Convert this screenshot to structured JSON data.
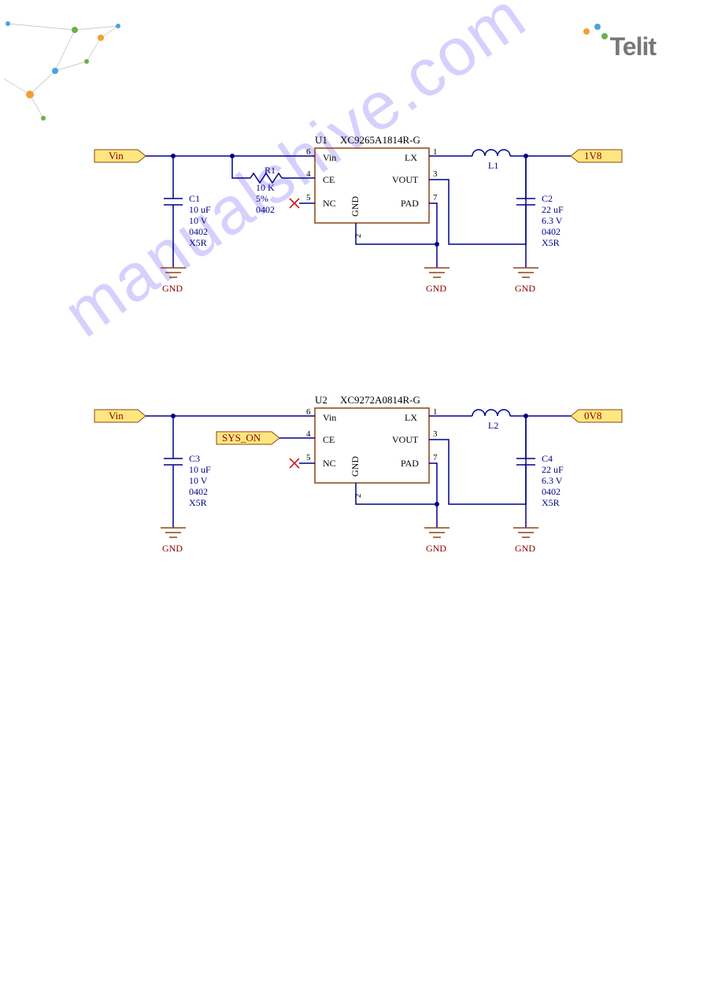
{
  "logo": {
    "text": "Telit"
  },
  "watermark": "manualshive.com",
  "circuit1": {
    "vin_label": "Vin",
    "out_label": "1V8",
    "ic": {
      "ref": "U1",
      "part": "XC9265A1814R-G",
      "pins": {
        "vin": "Vin",
        "ce": "CE",
        "nc": "NC",
        "lx": "LX",
        "vout": "VOUT",
        "pad": "PAD",
        "gnd": "GND",
        "n6": "6",
        "n4": "4",
        "n5": "5",
        "n1": "1",
        "n3": "3",
        "n7": "7",
        "n2": "2"
      }
    },
    "r1": {
      "ref": "R1",
      "val": "10 K",
      "tol": "5%",
      "pkg": "0402"
    },
    "c1": {
      "ref": "C1",
      "val": "10 uF",
      "volt": "10 V",
      "pkg": "0402",
      "di": "X5R"
    },
    "c2": {
      "ref": "C2",
      "val": "22 uF",
      "volt": "6.3 V",
      "pkg": "0402",
      "di": "X5R"
    },
    "l1": {
      "ref": "L1"
    },
    "gnd": "GND"
  },
  "circuit2": {
    "vin_label": "Vin",
    "out_label": "0V8",
    "sys_on": "SYS_ON",
    "ic": {
      "ref": "U2",
      "part": "XC9272A0814R-G",
      "pins": {
        "vin": "Vin",
        "ce": "CE",
        "nc": "NC",
        "lx": "LX",
        "vout": "VOUT",
        "pad": "PAD",
        "gnd": "GND",
        "n6": "6",
        "n4": "4",
        "n5": "5",
        "n1": "1",
        "n3": "3",
        "n7": "7",
        "n2": "2"
      }
    },
    "c3": {
      "ref": "C3",
      "val": "10 uF",
      "volt": "10 V",
      "pkg": "0402",
      "di": "X5R"
    },
    "c4": {
      "ref": "C4",
      "val": "22 uF",
      "volt": "6.3 V",
      "pkg": "0402",
      "di": "X5R"
    },
    "l2": {
      "ref": "L2"
    },
    "gnd": "GND"
  }
}
